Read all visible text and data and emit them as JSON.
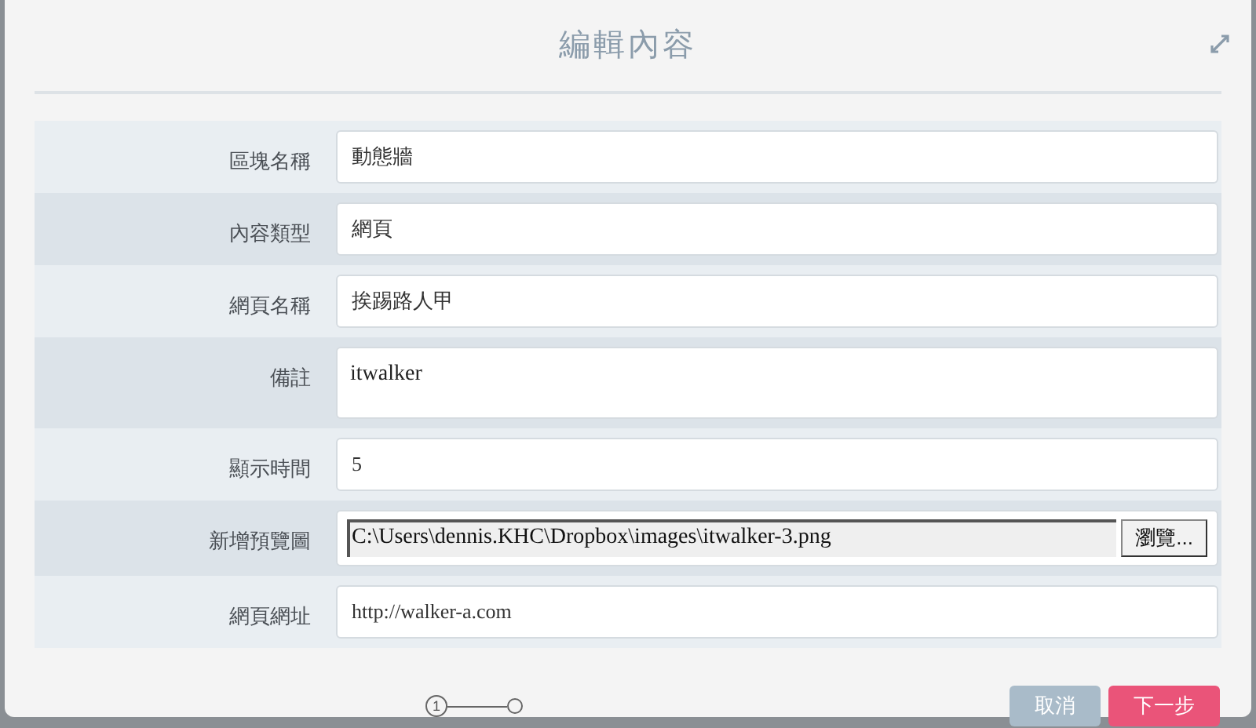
{
  "dialog": {
    "title": "編輯內容"
  },
  "fields": [
    {
      "label": "區塊名稱",
      "kind": "text",
      "value": "動態牆"
    },
    {
      "label": "內容類型",
      "kind": "text",
      "value": "網頁"
    },
    {
      "label": "網頁名稱",
      "kind": "text",
      "value": "挨踢路人甲"
    },
    {
      "label": "備註",
      "kind": "textarea",
      "value": "itwalker"
    },
    {
      "label": "顯示時間",
      "kind": "text",
      "value": "5"
    },
    {
      "label": "新增預覽圖",
      "kind": "file",
      "value": "C:\\Users\\dennis.KHC\\Dropbox\\images\\itwalker-3.png",
      "button": "瀏覽..."
    },
    {
      "label": "網頁網址",
      "kind": "text",
      "value": "http://walker-a.com"
    }
  ],
  "steps": [
    {
      "number": "1",
      "current": true
    },
    {
      "current": false
    }
  ],
  "buttons": [
    {
      "label": "取消",
      "kind": "secondary"
    },
    {
      "label": "下一步",
      "kind": "primary"
    }
  ]
}
